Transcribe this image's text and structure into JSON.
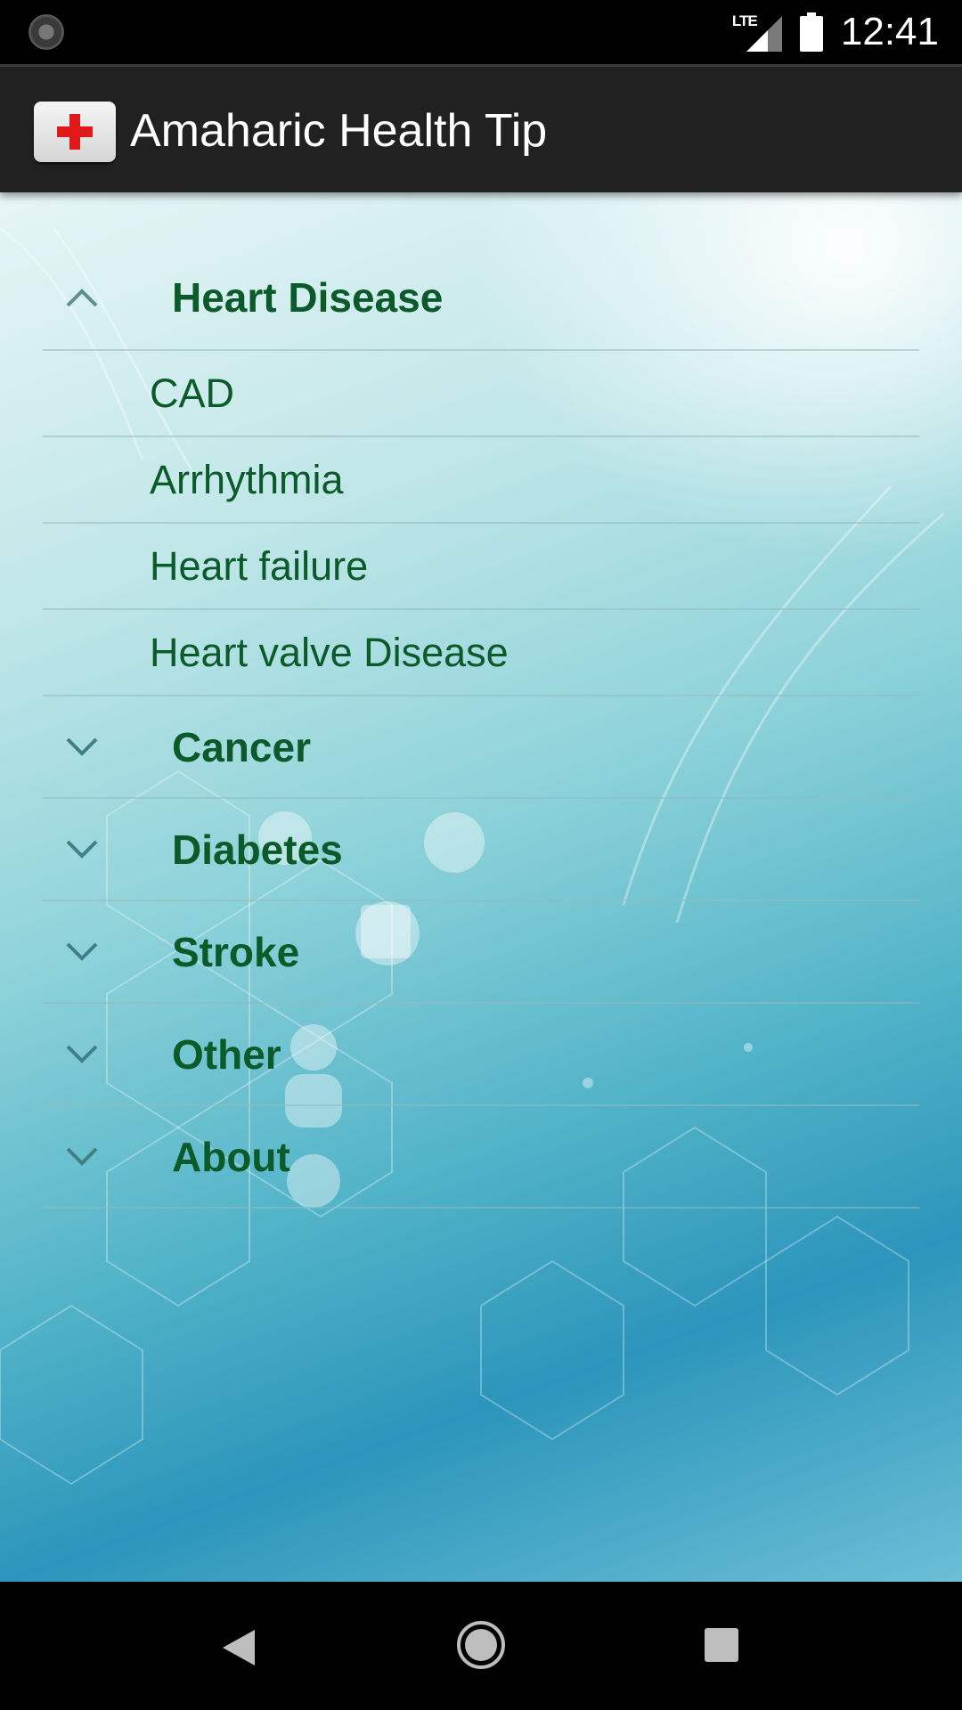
{
  "status_bar": {
    "network": "LTE",
    "time": "12:41"
  },
  "app_bar": {
    "title": "Amaharic Health Tip",
    "logo_icon": "red-cross-icon"
  },
  "groups": [
    {
      "title": "Heart Disease",
      "expanded": true,
      "children": [
        "CAD",
        "Arrhythmia",
        "Heart failure",
        "Heart valve Disease"
      ]
    },
    {
      "title": "Cancer",
      "expanded": false
    },
    {
      "title": "Diabetes",
      "expanded": false
    },
    {
      "title": "Stroke",
      "expanded": false
    },
    {
      "title": "Other",
      "expanded": false
    },
    {
      "title": "About",
      "expanded": false
    }
  ],
  "colors": {
    "text_green": "#0b5a2a",
    "app_bar": "#212121",
    "cross_red": "#e01818"
  },
  "nav_bar": {
    "icons": [
      "back-triangle-icon",
      "home-circle-icon",
      "recents-square-icon"
    ]
  }
}
